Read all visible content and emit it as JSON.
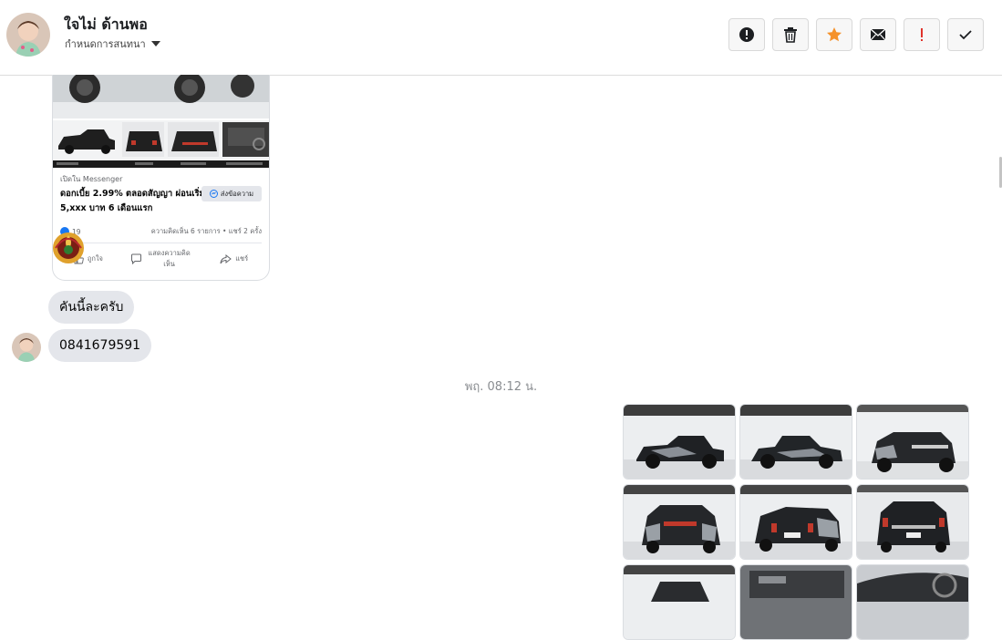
{
  "header": {
    "contact_name": "ใจไม่ ด้านพอ",
    "subtitle": "กำหนดการสนทนา"
  },
  "toolbar": {
    "buttons": [
      {
        "name": "alert-icon"
      },
      {
        "name": "trash-icon"
      },
      {
        "name": "star-icon",
        "color": "#f5922b"
      },
      {
        "name": "envelope-icon"
      },
      {
        "name": "exclamation-icon",
        "color": "#e0332b"
      },
      {
        "name": "check-icon"
      }
    ]
  },
  "shared_post": {
    "source": "เปิดใน Messenger",
    "title": "ดอกเบี้ย 2.99% ตลอดสัญญา ผ่อนเริ่ม 5,xxx บาท 6 เดือนแรก",
    "send_button": "ส่งข้อความ",
    "reactions": "19",
    "comments_shares": "ความคิดเห็น 6 รายการ • แชร์ 2 ครั้ง",
    "like": "ถูกใจ",
    "comment": "แสดงความคิดเห็น",
    "share": "แชร์"
  },
  "messages": [
    {
      "text": "คันนี้ละครับ"
    },
    {
      "text": "0841679591"
    }
  ],
  "timestamp": "พฤ. 08:12 น.",
  "photos": {
    "count_visible": 9
  }
}
